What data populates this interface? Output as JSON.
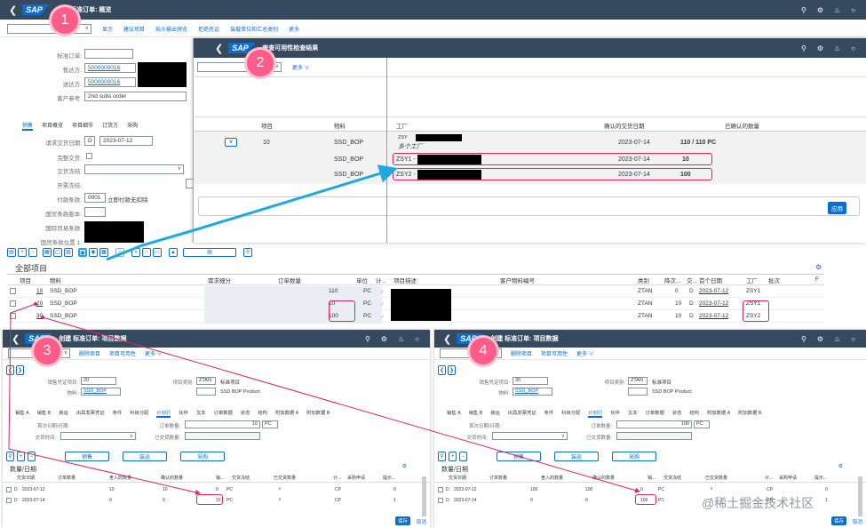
{
  "main": {
    "title": "创建 标准订单: 概览",
    "toolbar": [
      "显示",
      "建议项目",
      "抬头输出预览",
      "拒绝凭证",
      "装载单位和汇总类别",
      "更多"
    ],
    "fields": {
      "std_order_label": "标准订单:",
      "soldto_label": "售达方:",
      "soldto_value": "5000000016",
      "shipto_label": "送达方:",
      "shipto_value": "5000000016",
      "custref_label": "客户参考:",
      "custref_value": "2nd subs order"
    },
    "tabs": [
      "销售",
      "项目概览",
      "项目细节",
      "订货方",
      "采购"
    ],
    "sales": {
      "req_date_label": "请求交货日期:",
      "req_date_unit": "D",
      "req_date": "2023-07-12",
      "complete_delivery": "完整交货:",
      "delivery_block": "交货冻结:",
      "billing_block": "开票冻结:",
      "payment_terms_label": "付款条款:",
      "payment_terms_code": "0001",
      "payment_terms_text": "立即付款无扣除",
      "incoterms_version": "国贸条款版本:",
      "incoterms": "国际贸易条款:",
      "incoterms_loc": "国贸条款位置 1:"
    },
    "items_title": "全部项目",
    "items_headers": [
      "项目",
      "物料",
      "需求细分",
      "订单数量",
      "单位",
      "计...",
      "项目描述",
      "客户物料编号",
      "类别",
      "降次...",
      "交...",
      "首个日期",
      "工厂",
      "批次",
      "F"
    ],
    "items": [
      {
        "item": "10",
        "material": "SSD_BOP",
        "qty": "110",
        "unit": "PC",
        "cat": "ZTAN",
        "lvl": "0",
        "d": "D",
        "date": "2023-07-12",
        "plant": "ZSY1"
      },
      {
        "item": "20",
        "material": "SSD_BOP",
        "qty": "10",
        "unit": "PC",
        "cat": "ZTAN",
        "lvl": "10",
        "d": "D",
        "date": "2023-07-12",
        "plant": "ZSY1"
      },
      {
        "item": "30",
        "material": "SSD_BOP",
        "qty": "100",
        "unit": "PC",
        "cat": "ZTAN",
        "lvl": "10",
        "d": "D",
        "date": "2023-07-12",
        "plant": "ZSY2"
      }
    ]
  },
  "avail": {
    "title": "审查可用性检查结果",
    "more": "更多",
    "headers": {
      "item": "项目",
      "material": "物料",
      "plant": "工厂",
      "confirmed_date": "确认的交货日期",
      "confirmed_qty": "已确认的数量"
    },
    "row_item": "10",
    "materials": [
      "SSD_BOP",
      "SSD_BOP",
      "SSD_BOP"
    ],
    "multi_plant": "多个工厂",
    "zsy_prefix": "ZSY",
    "plants": [
      "ZSY1 -",
      "ZSY2 -"
    ],
    "dates": [
      "2023-07-14",
      "2023-07-14",
      "2023-07-14"
    ],
    "qtys": [
      "110 / 110 PC",
      "10",
      "100"
    ],
    "apply": "应用"
  },
  "detail": {
    "title": "创建 标准订单: 项目数据",
    "toolbar": [
      "删除项目",
      "项目可用性",
      "更多"
    ],
    "so_item_label": "销售凭证项目:",
    "item_cat_label": "项目类别:",
    "item_cat_value": "ZTAN",
    "std_item": "标准项目",
    "material_label": "物料:",
    "material_value": "SSD_BOP",
    "product": "SSD BOP Product",
    "tabs": [
      "销售 A",
      "销售 B",
      "装运",
      "出具发票凭证",
      "条件",
      "科目分配",
      "计划行",
      "伙伴",
      "文本",
      "订单数据",
      "状态",
      "结构",
      "附加数据 A",
      "附加数据 B"
    ],
    "order_qty_label": "订单数量:",
    "confirmed_label": "已交货数量:",
    "delivery_date_label": "首次日期/日期:",
    "delivery_block_label": "交货时间:",
    "btns": [
      "销售",
      "装运",
      "采购"
    ],
    "sched_title": "数量/日期",
    "sched_headers": [
      "交货日期",
      "订单数量",
      "舍入的数量",
      "确认的数量",
      "销...",
      "交货冻结",
      "已交货数量",
      "计...",
      "采购申请",
      "提示..."
    ],
    "left": {
      "item": "20",
      "qty": "10",
      "rows": [
        {
          "date": "2023-07-12",
          "order": "10",
          "round": "10",
          "conf": "0",
          "unit": "PC",
          "cat": "CP",
          "pr": "0"
        },
        {
          "date": "2023-07-14",
          "order": "0",
          "round": "0",
          "conf": "10",
          "unit": "PC",
          "cat": "CP",
          "pr": "1"
        }
      ]
    },
    "right": {
      "item": "30",
      "qty": "100",
      "rows": [
        {
          "date": "2023-07-12",
          "order": "100",
          "round": "100",
          "conf": "0",
          "unit": "PC",
          "cat": "CP",
          "pr": "0"
        },
        {
          "date": "2023-07-14",
          "order": "0",
          "round": "0",
          "conf": "100",
          "unit": "PC",
          "cat": "CP",
          "pr": "1"
        }
      ]
    },
    "save": "保存",
    "cancel": "取消"
  },
  "steps": [
    "1",
    "2",
    "3",
    "4"
  ],
  "watermark": "@稀土掘金技术社区",
  "unit_pc": "PC",
  "d": "D",
  "sap": "SAP"
}
